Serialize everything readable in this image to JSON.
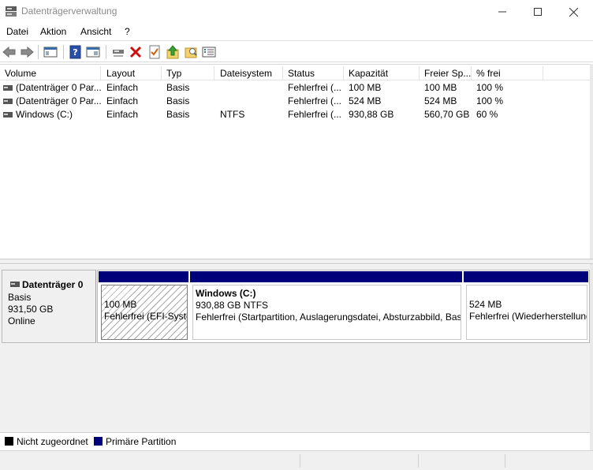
{
  "window": {
    "title": "Datenträgerverwaltung",
    "controls": [
      "minimize-icon",
      "maximize-icon",
      "close-icon"
    ]
  },
  "menu": [
    {
      "label": "Datei"
    },
    {
      "label": "Aktion"
    },
    {
      "label": "Ansicht"
    },
    {
      "label": "?"
    }
  ],
  "toolbar": {
    "buttons": [
      "back-arrow-icon",
      "forward-arrow-icon",
      "console-tree-icon",
      "help-icon",
      "properties-panel-icon",
      "connect-icon",
      "delete-icon",
      "checklist-icon",
      "upload-icon",
      "folder-search-icon",
      "settings-list-icon"
    ]
  },
  "volume_list": {
    "columns": [
      "Volume",
      "Layout",
      "Typ",
      "Dateisystem",
      "Status",
      "Kapazität",
      "Freier Sp...",
      "% frei"
    ],
    "rows": [
      {
        "volume": "(Datenträger 0 Par...",
        "layout": "Einfach",
        "typ": "Basis",
        "dateisystem": "",
        "status": "Fehlerfrei (...",
        "kapazitaet": "100 MB",
        "frei": "100 MB",
        "prozent": "100 %"
      },
      {
        "volume": "(Datenträger 0 Par...",
        "layout": "Einfach",
        "typ": "Basis",
        "dateisystem": "",
        "status": "Fehlerfrei (...",
        "kapazitaet": "524 MB",
        "frei": "524 MB",
        "prozent": "100 %"
      },
      {
        "volume": "Windows (C:)",
        "layout": "Einfach",
        "typ": "Basis",
        "dateisystem": "NTFS",
        "status": "Fehlerfrei (...",
        "kapazitaet": "930,88 GB",
        "frei": "560,70 GB",
        "prozent": "60 %"
      }
    ]
  },
  "disk": {
    "name": "Datenträger 0",
    "type": "Basis",
    "size": "931,50 GB",
    "state": "Online",
    "partitions": [
      {
        "title": "",
        "line1": "100 MB",
        "line2": "Fehlerfrei (EFI-Systempartition)"
      },
      {
        "title": "Windows  (C:)",
        "line1": "930,88 GB NTFS",
        "line2": "Fehlerfrei (Startpartition, Auslagerungsdatei, Absturzabbild, Basisdatenpartition)"
      },
      {
        "title": "",
        "line1": "524 MB",
        "line2": "Fehlerfrei (Wiederherstellungspartition)"
      }
    ]
  },
  "legend": [
    {
      "label": "Nicht zugeordnet",
      "color": "#000000"
    },
    {
      "label": "Primäre Partition",
      "color": "#00007a"
    }
  ]
}
